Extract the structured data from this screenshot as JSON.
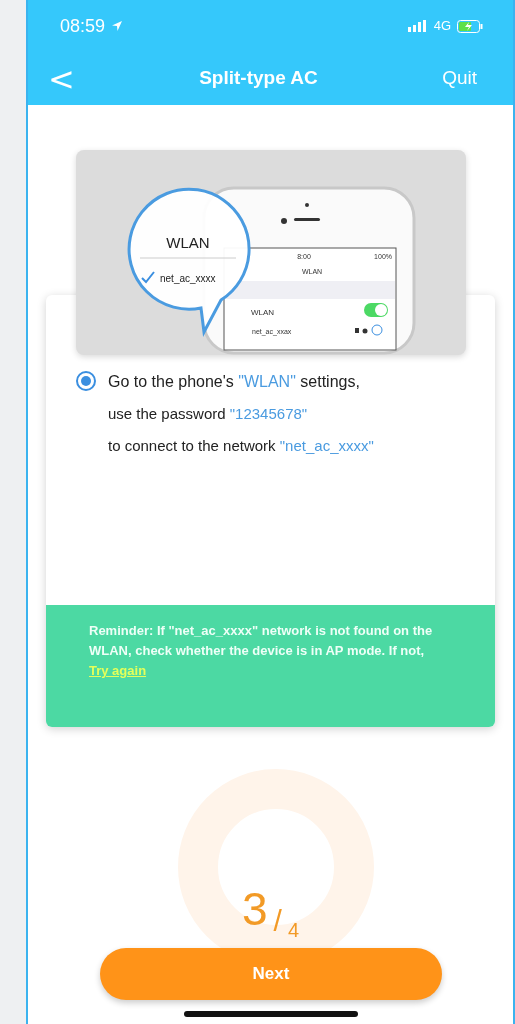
{
  "status_bar": {
    "time": "08:59",
    "network": "4G"
  },
  "nav": {
    "back": "<",
    "title": "Split-type AC",
    "action": "Quit"
  },
  "illustration": {
    "bubble_title": "WLAN",
    "bubble_network": "net_ac_xxxx",
    "phone_time": "8:00",
    "phone_battery": "100%",
    "phone_title": "WLAN",
    "wlan_row": "WLAN",
    "wlan_on": true,
    "network_row": "net_ac_xxax"
  },
  "step": {
    "selected": true,
    "lines": [
      [
        {
          "text": "Go to the phone's ",
          "highlight": false
        },
        {
          "text": "\"WLAN\"",
          "highlight": true
        },
        {
          "text": " settings,",
          "highlight": false
        }
      ],
      [
        {
          "text": "use the password ",
          "highlight": false
        },
        {
          "text": "\"12345678\"",
          "highlight": true
        }
      ],
      [
        {
          "text": "to connect to the network ",
          "highlight": false
        },
        {
          "text": "\"net_ac_xxxx\"",
          "highlight": true
        }
      ]
    ]
  },
  "reminder": {
    "text": "Reminder: If \"net_ac_xxxx\" network is not found on the WLAN, check whether the device is in AP mode. If not, ",
    "link": "Try again"
  },
  "progress": {
    "current": "3",
    "separator": "/",
    "total": "4"
  },
  "next_button": "Next"
}
